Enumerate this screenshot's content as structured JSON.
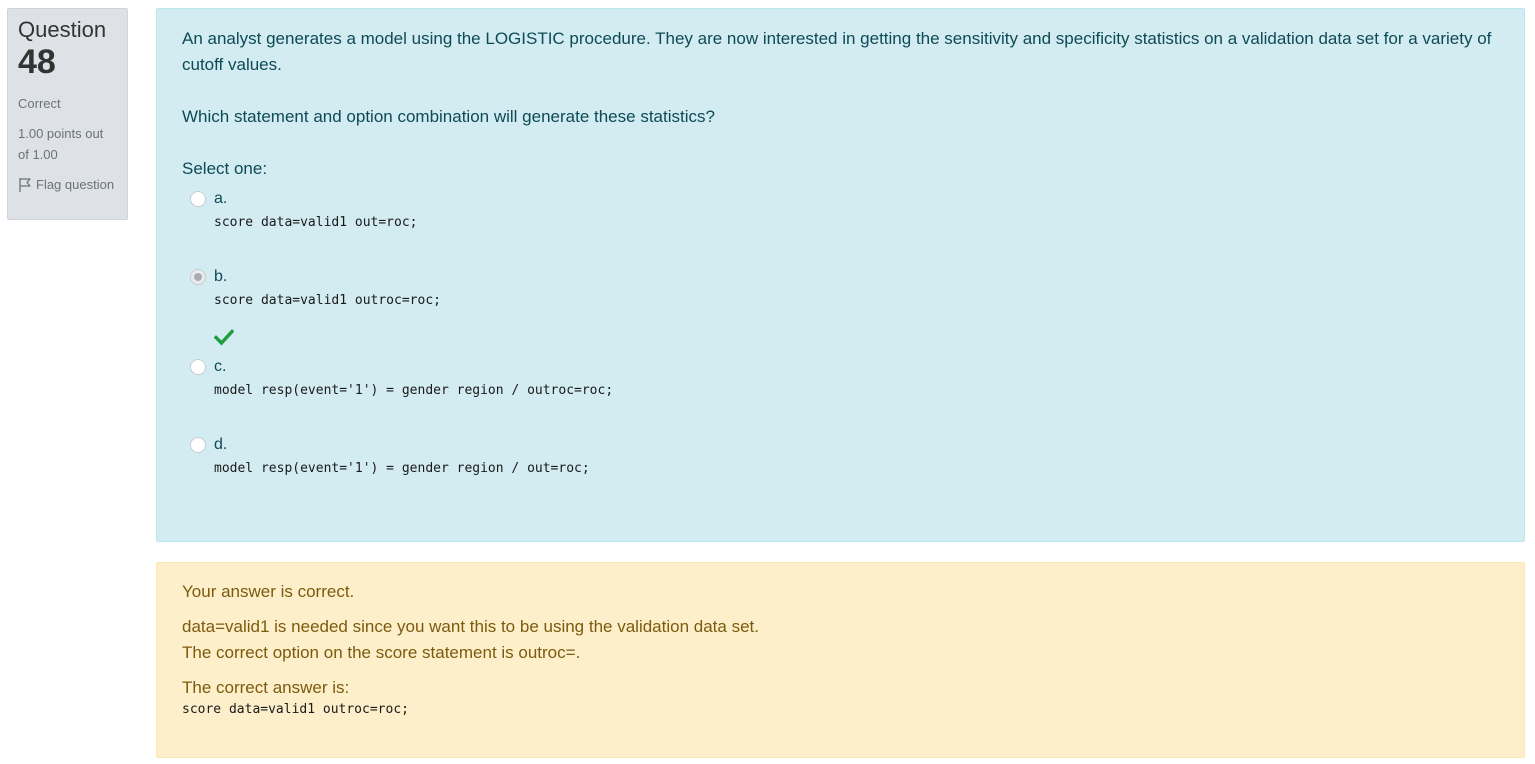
{
  "info": {
    "question_word": "Question",
    "question_number": "48",
    "state": "Correct",
    "grade": "1.00 points out of 1.00",
    "flag_label": "Flag question",
    "flag_icon": "flag-icon"
  },
  "question": {
    "text_line": "An analyst generates a model using the LOGISTIC procedure. They are now interested in getting the sensitivity and specificity statistics on a validation data set for a variety of cutoff values.",
    "text_line2": "Which statement and option combination will generate these statistics?",
    "prompt": "Select one:",
    "options": [
      {
        "letter": "a.",
        "code": "score data=valid1 out=roc;",
        "selected": false
      },
      {
        "letter": "b.",
        "code": "score data=valid1 outroc=roc;",
        "selected": true,
        "correct_icon": "check-icon"
      },
      {
        "letter": "c.",
        "code": "model resp(event='1') = gender region / outroc=roc;",
        "selected": false
      },
      {
        "letter": "d.",
        "code": "model resp(event='1') = gender region / out=roc;",
        "selected": false
      }
    ]
  },
  "feedback": {
    "specific": "Your answer is correct.",
    "general_line1": "data=valid1 is needed since you want this to be using the validation data set.",
    "general_line2": "The correct option on the score statement is outroc=.",
    "right_answer_label": "The correct answer is:",
    "right_answer_code": "score data=valid1 outroc=roc;"
  },
  "colors": {
    "question_bg": "#d2ecf1",
    "question_text": "#0e4a56",
    "feedback_bg": "#fcefca",
    "feedback_text": "#7d5a0d",
    "info_bg": "#dee2e6",
    "correct_check": "#1f9d3f"
  }
}
